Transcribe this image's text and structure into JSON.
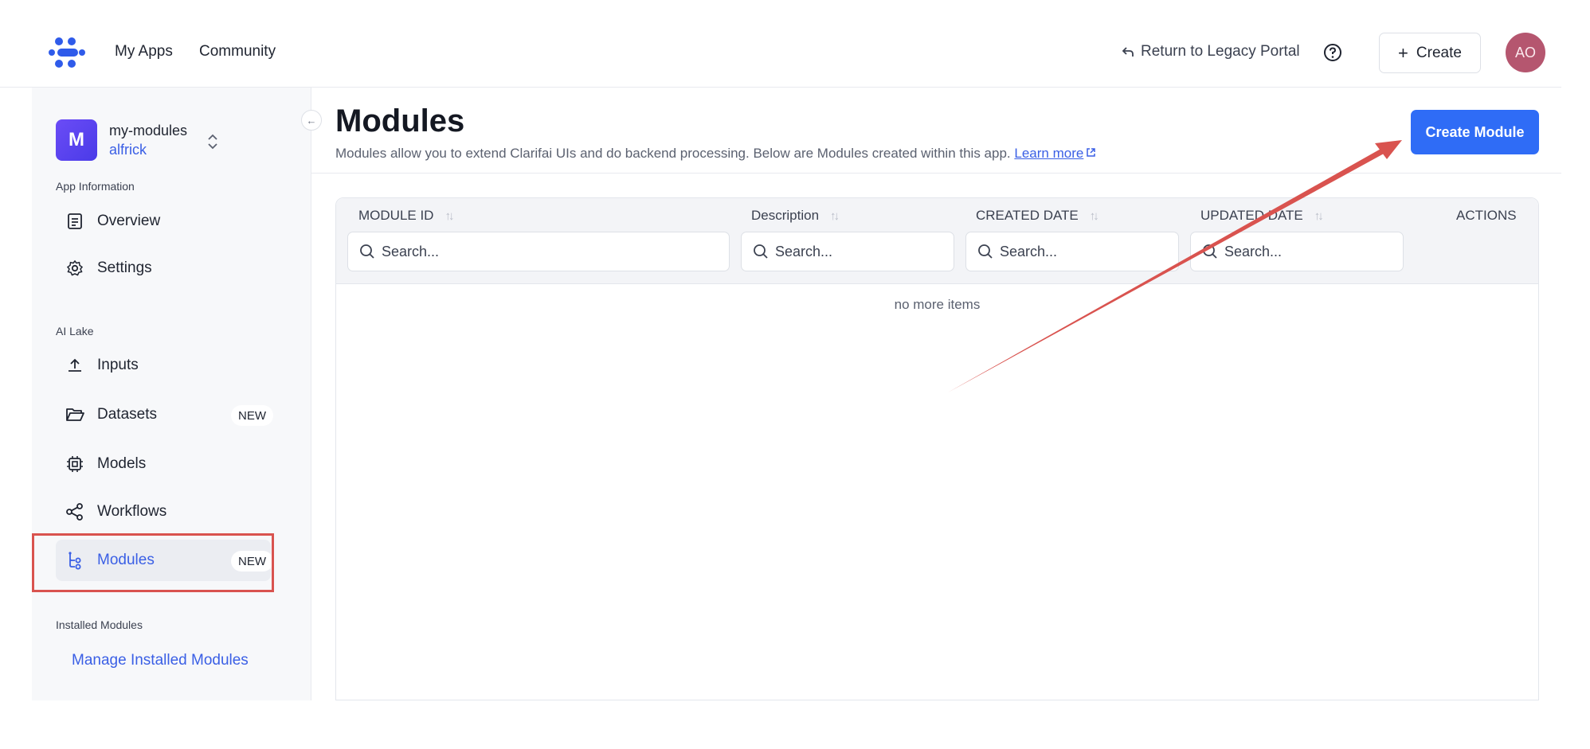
{
  "header": {
    "nav": [
      "My Apps",
      "Community"
    ],
    "legacy_label": "Return to Legacy Portal",
    "create_label": "Create",
    "avatar_initials": "AO"
  },
  "sidebar": {
    "app_initial": "M",
    "app_name": "my-modules",
    "app_user": "alfrick",
    "sections": {
      "app_info": "App Information",
      "ai_lake": "AI Lake",
      "installed": "Installed Modules"
    },
    "items": [
      {
        "label": "Overview",
        "icon": "document-icon"
      },
      {
        "label": "Settings",
        "icon": "gear-icon"
      },
      {
        "label": "Inputs",
        "icon": "upload-icon"
      },
      {
        "label": "Datasets",
        "icon": "folder-icon",
        "badge": "NEW"
      },
      {
        "label": "Models",
        "icon": "chip-icon"
      },
      {
        "label": "Workflows",
        "icon": "share-icon"
      },
      {
        "label": "Modules",
        "icon": "tree-icon",
        "badge": "NEW",
        "active": true
      }
    ],
    "manage_link": "Manage Installed Modules"
  },
  "main": {
    "title": "Modules",
    "description": "Modules allow you to extend Clarifai UIs and do backend processing. Below are Modules created within this app.",
    "learn_more": "Learn more",
    "create_button": "Create Module",
    "table": {
      "columns": [
        "MODULE ID",
        "Description",
        "CREATED DATE",
        "UPDATED DATE",
        "ACTIONS"
      ],
      "search_placeholder": "Search...",
      "empty_text": "no more items"
    }
  },
  "colors": {
    "accent": "#2f6cf6",
    "link": "#3a5fe5",
    "annotation": "#d9534f",
    "avatar": "#b5566f"
  }
}
